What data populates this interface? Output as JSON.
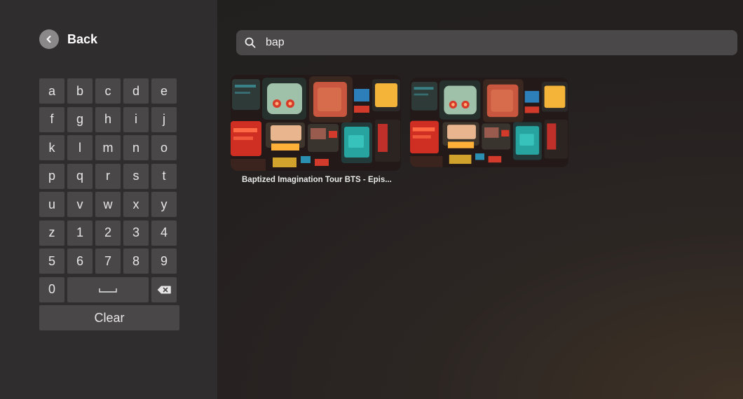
{
  "nav": {
    "back_label": "Back",
    "back_icon": "chevron-left-icon"
  },
  "keyboard": {
    "keys": [
      "a",
      "b",
      "c",
      "d",
      "e",
      "f",
      "g",
      "h",
      "i",
      "j",
      "k",
      "l",
      "m",
      "n",
      "o",
      "p",
      "q",
      "r",
      "s",
      "t",
      "u",
      "v",
      "w",
      "x",
      "y",
      "z",
      "1",
      "2",
      "3",
      "4",
      "5",
      "6",
      "7",
      "8",
      "9",
      "0"
    ],
    "space_icon": "space-bar-icon",
    "backspace_icon": "backspace-icon",
    "clear_label": "Clear"
  },
  "search": {
    "value": "bap",
    "icon": "search-icon"
  },
  "results": [
    {
      "title": "Baptized Imagination Tour BTS - Epis..."
    },
    {
      "title": ""
    }
  ],
  "colors": {
    "panel": "#2f2d2e",
    "key": "#494748",
    "search_bg": "#4a4849",
    "back_circle": "#8a8889"
  }
}
